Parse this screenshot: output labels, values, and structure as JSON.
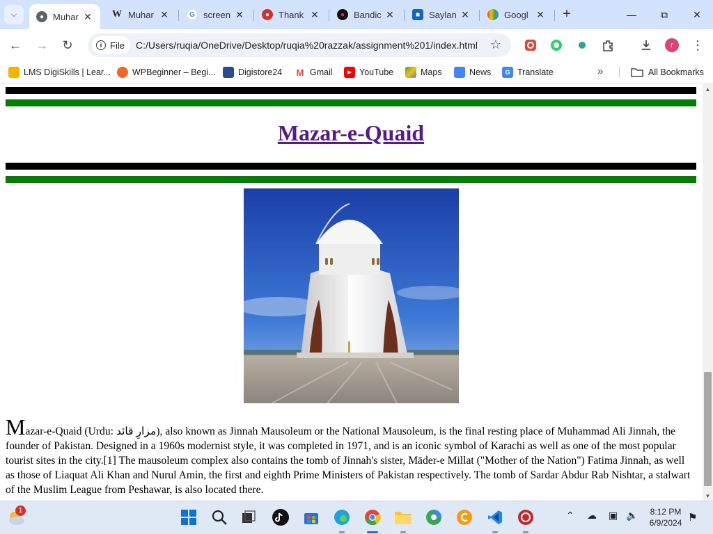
{
  "browser": {
    "tabs": [
      {
        "title": "Muhar",
        "icon": "globe-icon",
        "active": true
      },
      {
        "title": "Muhar",
        "icon": "wikipedia-icon"
      },
      {
        "title": "screen",
        "icon": "google-icon"
      },
      {
        "title": "Thank",
        "icon": "record-icon"
      },
      {
        "title": "Bandic",
        "icon": "bandicam-icon"
      },
      {
        "title": "Saylan",
        "icon": "contact-icon"
      },
      {
        "title": "Googl",
        "icon": "rainbow-icon"
      }
    ],
    "address": {
      "chip_label": "File",
      "url": "C:/Users/ruqia/OneDrive/Desktop/ruqia%20razzak/assignment%201/index.html"
    },
    "profile_initial": "r",
    "bookmarks": [
      {
        "label": "LMS DigiSkills | Lear...",
        "color": "#f4b400"
      },
      {
        "label": "WPBeginner – Begi...",
        "color": "#f26522"
      },
      {
        "label": "Digistore24",
        "color": "#2e4a8f"
      },
      {
        "label": "Gmail",
        "color": "#ea4335"
      },
      {
        "label": "YouTube",
        "color": "#ff0000"
      },
      {
        "label": "Maps",
        "color": "#34a853"
      },
      {
        "label": "News",
        "color": "#4285f4"
      },
      {
        "label": "Translate",
        "color": "#4285f4"
      }
    ],
    "all_bookmarks_label": "All Bookmarks"
  },
  "page": {
    "heading": "Mazar-e-Quaid",
    "dropcap": "M",
    "paragraph_rest": "azar-e-Quaid (Urdu: مزارِ قائد), also known as Jinnah Mausoleum or the National Mausoleum, is the final resting place of Muhammad Ali Jinnah, the founder of Pakistan. Designed in a 1960s modernist style, it was completed in 1971, and is an iconic symbol of Karachi as well as one of the most popular tourist sites in the city.[1] The mausoleum complex also contains the tomb of Jinnah's sister, Māder-e Millat (\"Mother of the Nation\") Fatima Jinnah, as well as those of Liaquat Ali Khan and Nurul Amin, the first and eighth Prime Ministers of Pakistan respectively. The tomb of Sardar Abdur Rab Nishtar, a stalwart of the Muslim League from Peshawar, is also located there."
  },
  "taskbar": {
    "weather_badge": "1",
    "time": "8:12 PM",
    "date": "6/9/2024"
  }
}
